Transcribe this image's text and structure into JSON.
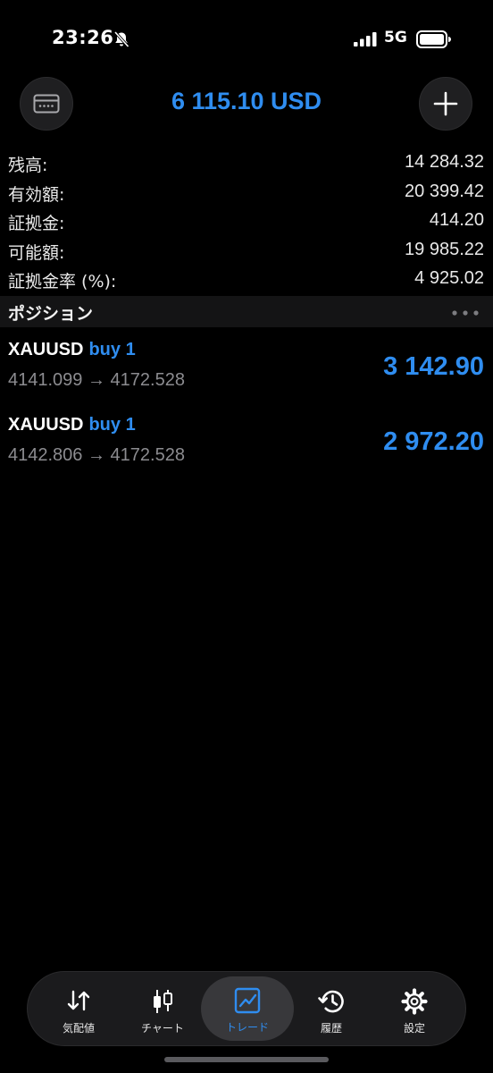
{
  "status": {
    "time": "23:26",
    "network": "5G"
  },
  "header": {
    "balance": "6 115.10 USD"
  },
  "account": {
    "rows": [
      {
        "label": "残高:",
        "value": "14 284.32"
      },
      {
        "label": "有効額:",
        "value": "20 399.42"
      },
      {
        "label": "証拠金:",
        "value": "414.20"
      },
      {
        "label": "可能額:",
        "value": "19 985.22"
      },
      {
        "label": "証拠金率 (%):",
        "value": "4 925.02"
      }
    ]
  },
  "positions": {
    "title": "ポジション",
    "items": [
      {
        "symbol": "XAUUSD",
        "side": "buy 1",
        "prices": "4141.099 → 4172.528",
        "profit": "3 142.90"
      },
      {
        "symbol": "XAUUSD",
        "side": "buy 1",
        "prices": "4142.806 → 4172.528",
        "profit": "2 972.20"
      }
    ]
  },
  "tabs": [
    {
      "label": "気配値",
      "icon": "arrows-updown-icon"
    },
    {
      "label": "チャート",
      "icon": "candlestick-icon"
    },
    {
      "label": "トレード",
      "icon": "trade-chart-icon",
      "active": true
    },
    {
      "label": "履歴",
      "icon": "history-icon"
    },
    {
      "label": "設定",
      "icon": "gear-icon"
    }
  ],
  "colors": {
    "accent": "#2f8df0",
    "background": "#000000",
    "muted": "#8c8c90"
  }
}
